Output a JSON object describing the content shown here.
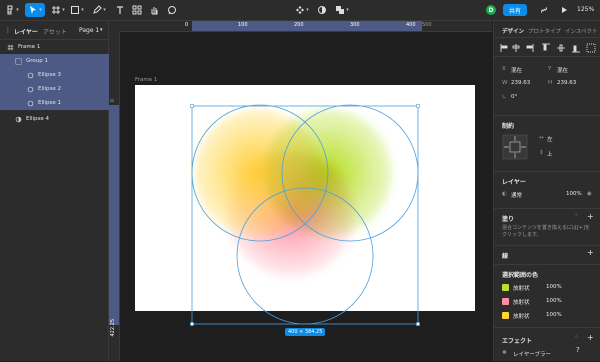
{
  "toolbar": {
    "share_label": "共有",
    "avatar_initial": "D",
    "zoom": "125%"
  },
  "left_panel": {
    "tabs": [
      "レイヤー",
      "アセット",
      "Page 1"
    ],
    "layers": [
      {
        "name": "Frame 1",
        "level": 0,
        "icon": "frame-icon",
        "selected": false
      },
      {
        "name": "Group 1",
        "level": 1,
        "icon": "group-icon",
        "selected": true
      },
      {
        "name": "Ellipse 3",
        "level": 2,
        "icon": "ellipse-icon",
        "selected": true
      },
      {
        "name": "Ellipse 2",
        "level": 2,
        "icon": "ellipse-icon",
        "selected": true
      },
      {
        "name": "Ellipse 1",
        "level": 2,
        "icon": "ellipse-icon",
        "selected": true
      },
      {
        "name": "Ellipse 4",
        "level": 1,
        "icon": "blur-ellipse-icon",
        "selected": false
      }
    ]
  },
  "rulers": {
    "top": [
      "0",
      "100",
      "200",
      "300",
      "400",
      "500"
    ],
    "left": [
      "0",
      "422.25"
    ]
  },
  "canvas": {
    "frame_label": "Frame 1",
    "selection_size": "400 × 384.25",
    "ellipse_colors": [
      "#ffd43b",
      "#b8e02d",
      "#ff8fa0"
    ]
  },
  "right_panel": {
    "tabs": [
      "デザイン",
      "プロトタイプ",
      "インスペクト"
    ],
    "position": {
      "x_label": "X",
      "x_value": "混在",
      "y_label": "Y",
      "y_value": "混在"
    },
    "size": {
      "w_label": "W",
      "w_value": "239.63",
      "h_label": "H",
      "h_value": "239.63"
    },
    "rotation": "0°",
    "constraints_title": "制約",
    "constraint_h": "左",
    "constraint_v": "上",
    "layer_title": "レイヤー",
    "blend_mode": "通常",
    "layer_opacity": "100%",
    "fill_title": "塗り",
    "fill_hint": "混合コンテンツを置き換えるには[+]をクリックします。",
    "stroke_title": "線",
    "selection_colors_title": "選択範囲の色",
    "selection_colors": [
      {
        "label": "放射状",
        "opacity": "100%",
        "color": "#b8e02d"
      },
      {
        "label": "放射状",
        "opacity": "100%",
        "color": "#ff8fa0"
      },
      {
        "label": "放射状",
        "opacity": "100%",
        "color": "#ffd43b"
      }
    ],
    "effects_title": "エフェクト",
    "effect_name": "レイヤーブラー",
    "help": "?"
  }
}
